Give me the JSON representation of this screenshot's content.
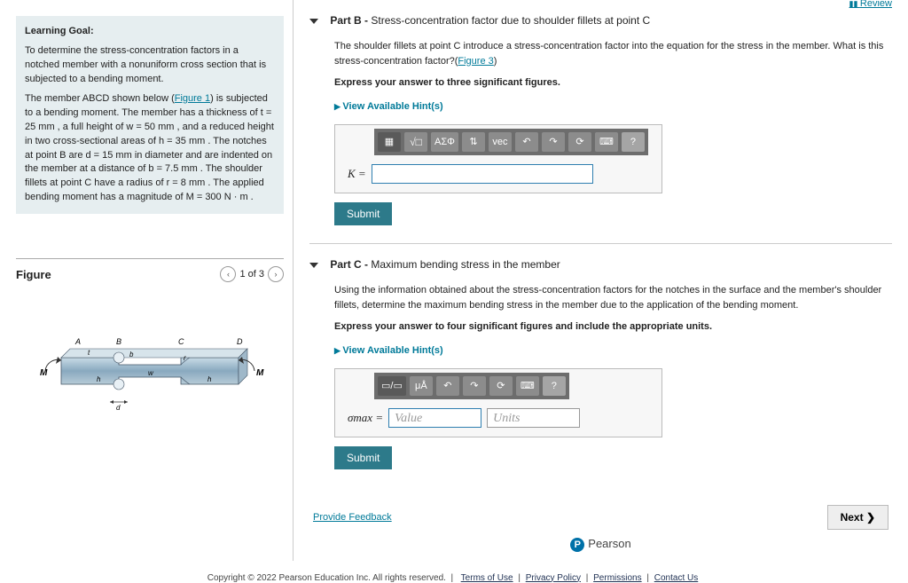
{
  "review": "Review",
  "learning": {
    "title": "Learning Goal:",
    "p1_a": "To determine the stress-concentration factors in a notched member with a nonuniform cross section that is subjected to a bending moment.",
    "p2_a": "The member ABCD shown below (",
    "fig1": "Figure 1",
    "p2_b": ") is subjected to a bending moment. The member has a thickness of t = 25 mm , a full height of w = 50 mm , and a reduced height in two cross-sectional areas of h = 35 mm . The notches at point B are d = 15 mm in diameter and are indented on the member at a distance of b = 7.5 mm . The shoulder fillets at point C have a radius of r = 8 mm . The applied bending moment has a magnitude of M = 300 N · m ."
  },
  "figure": {
    "title": "Figure",
    "pager": "1 of 3"
  },
  "partB": {
    "label": "Part B - ",
    "title": "Stress-concentration factor due to shoulder fillets at point C",
    "text_a": "The shoulder fillets at point C introduce a stress-concentration factor into the equation for the stress in the member. What is this stress-concentration factor?(",
    "fig3": "Figure 3",
    "text_b": ")",
    "express": "Express your answer to three significant figures.",
    "hints": "View Available Hint(s)",
    "var": "K =",
    "submit": "Submit"
  },
  "partC": {
    "label": "Part C - ",
    "title": "Maximum bending stress in the member",
    "text": "Using the information obtained about the stress-concentration factors for the notches in the surface and the member's shoulder fillets, determine the maximum bending stress in the member due to the application of the bending moment.",
    "express": "Express your answer to four significant figures and include the appropriate units.",
    "hints": "View Available Hint(s)",
    "var": "σmax =",
    "val_ph": "Value",
    "unit_ph": "Units",
    "submit": "Submit"
  },
  "toolbar": {
    "templates": "▦",
    "sqrt": "√□",
    "greek": "ΑΣΦ",
    "arrows": "⇅",
    "vec": "vec",
    "undo": "↶",
    "redo": "↷",
    "reset": "⟳",
    "keyboard": "⌨",
    "help": "?",
    "units": "μÅ",
    "frac": "▭/▭"
  },
  "footer": {
    "feedback": "Provide Feedback",
    "next": "Next ❯",
    "pearson": "Pearson",
    "copyright": "Copyright © 2022 Pearson Education Inc. All rights reserved.",
    "links": [
      "Terms of Use",
      "Privacy Policy",
      "Permissions",
      "Contact Us"
    ]
  }
}
